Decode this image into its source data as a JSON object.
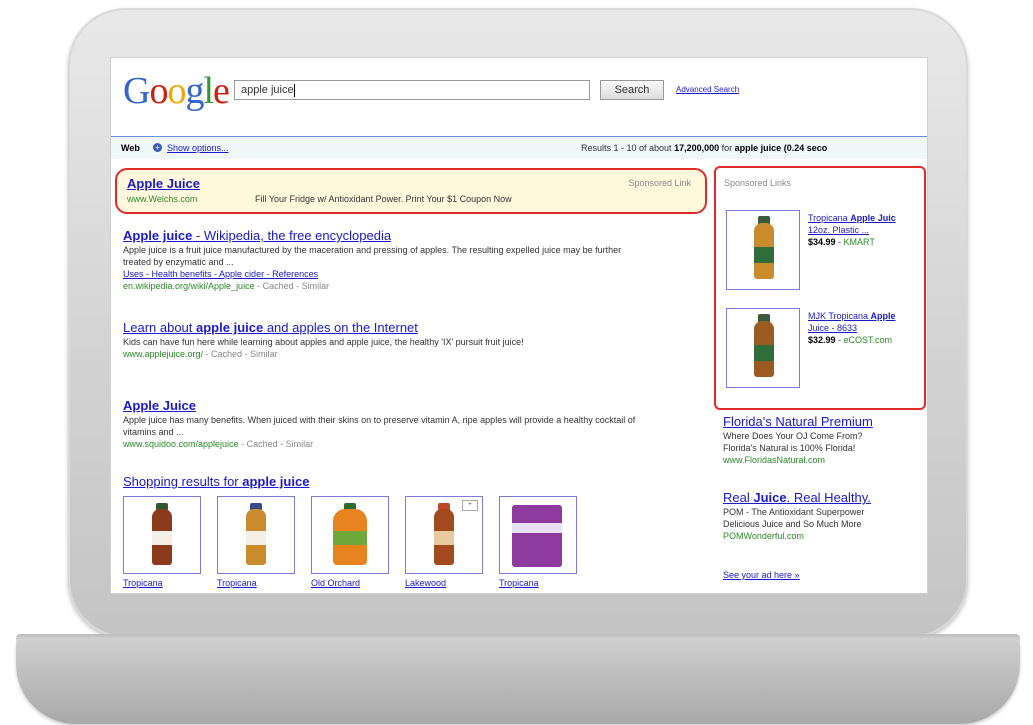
{
  "colors": {
    "highlight_border": "#e12b2b",
    "sponsored_bg": "#fff8dd",
    "link_blue": "#1a1acc",
    "url_green": "#2a8a2a",
    "logo_blue": "#3366cc",
    "logo_red": "#cc2211",
    "logo_yellow": "#eeaa00",
    "logo_green": "#339933"
  },
  "header": {
    "logo_letters": [
      "G",
      "o",
      "o",
      "g",
      "l",
      "e"
    ],
    "search_value": "apple juice",
    "search_button": "Search",
    "advanced_link": "Advanced Search"
  },
  "results_bar": {
    "web_label": "Web",
    "show_options": "Show options...",
    "stats_prefix": "Results 1 - 10 of about",
    "stats_count": "17,200,000",
    "stats_for": "for",
    "stats_query": "apple juice",
    "stats_time": "(0.24 seco"
  },
  "sponsored_top": {
    "title": "Apple Juice",
    "url": "www.Welchs.com",
    "description": "Fill Your Fridge w/ Antioxidant Power. Print Your $1 Coupon Now",
    "label": "Sponsored Link"
  },
  "results": [
    {
      "title_bold": "Apple juice",
      "title_rest": " - Wikipedia, the free encyclopedia",
      "snippet": "Apple juice is a fruit juice manufactured by the maceration and pressing of apples. The resulting expelled juice may be further treated by enzymatic and ...",
      "links": "Uses - Health benefits - Apple cider - References",
      "url": "en.wikipedia.org/wiki/Apple_juice",
      "meta": " - Cached - Similar"
    },
    {
      "title_bold": "apple juice",
      "title_pre": "Learn about ",
      "title_rest": " and apples on the Internet",
      "snippet": "Kids can have fun here while learning about apples and apple juice, the healthy 'IX' pursuit fruit juice!",
      "url": "www.applejuice.org/",
      "meta": " - Cached - Similar"
    },
    {
      "title_bold": "Apple Juice",
      "snippet": "Apple juice has many benefits. When juiced with their skins on to preserve vitamin A, ripe apples will provide a healthy cocktail of vitamins and ...",
      "url": "www.squidoo.com/applejuice",
      "meta": " - Cached - Similar"
    }
  ],
  "shopping": {
    "title_pre": "Shopping results for ",
    "title_bold": "apple juice",
    "items": [
      {
        "caption": "Tropicana",
        "bottle": "#8b3a1c",
        "cap": "#2e5a2e"
      },
      {
        "caption": "Tropicana",
        "bottle": "#c98b2b",
        "cap": "#3a4a8a"
      },
      {
        "caption": "Old Orchard",
        "bottle": "#e8841f",
        "cap": "#2c6b2c"
      },
      {
        "caption": "Lakewood",
        "bottle": "#a04a1e",
        "cap": "#c3472b"
      },
      {
        "caption": "Tropicana",
        "bottle": "#8e3a9e",
        "cap": "#8e3a9e"
      }
    ]
  },
  "sponsored_right": {
    "heading": "Sponsored Links",
    "products": [
      {
        "title_pre": "Tropicana ",
        "title_bold": "Apple Juic",
        "title_line2": "12oz. Plastic ...",
        "price": "$34.99",
        "store": "KMART"
      },
      {
        "title_pre": "MJK Tropicana ",
        "title_bold": "Apple",
        "title_line2": "Juice - 8633",
        "price": "$32.99",
        "store": "eCOST.com"
      }
    ]
  },
  "right_ads": [
    {
      "title": "Florida's Natural Premium",
      "line1": "Where Does Your OJ Come From?",
      "line2": "Florida's Natural is 100% Florida!",
      "url": "www.FloridasNatural.com"
    },
    {
      "title_pre": "Real ",
      "title_bold": "Juice",
      "title_rest": ". Real Healthy.",
      "line1": "POM - The Antioxidant Superpower",
      "line2": "Delicious Juice and So Much More",
      "url": "POMWonderful.com"
    }
  ],
  "more_ads": "See your ad here »"
}
